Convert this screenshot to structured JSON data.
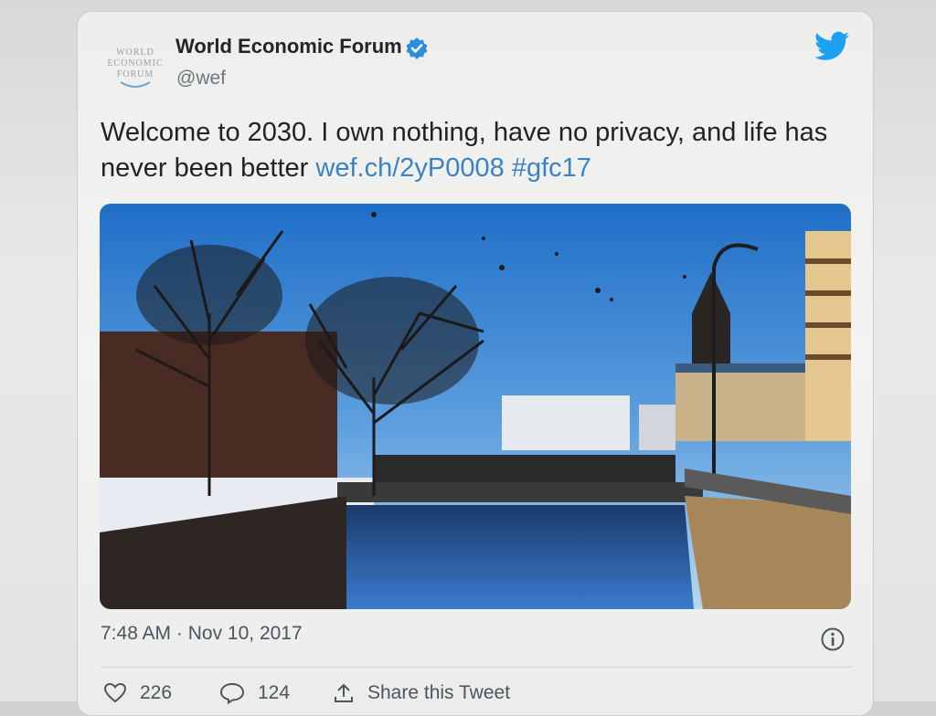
{
  "tweet": {
    "author_name": "World Economic Forum",
    "handle": "@wef",
    "avatar_text": [
      "WORLD",
      "ECONOMIC",
      "FORUM"
    ],
    "text_main": "Welcome to 2030. I own nothing, have no privacy, and life has never been better ",
    "link": "wef.ch/2yP0008",
    "hashtag": "#gfc17",
    "time": "7:48 AM",
    "separator": " · ",
    "date": "Nov 10, 2017"
  },
  "actions": {
    "likes": "226",
    "replies": "124",
    "share_label": "Share this Tweet"
  },
  "icons": {
    "brand": "twitter-bird-icon",
    "verified": "verified-badge-icon",
    "info": "info-icon",
    "like": "heart-icon",
    "reply": "speech-bubble-icon",
    "share": "share-arrow-icon"
  },
  "colors": {
    "twitter_blue": "#1da1f2",
    "link_blue": "#3a83c4",
    "text": "#1f2326",
    "muted": "#4b5560"
  }
}
